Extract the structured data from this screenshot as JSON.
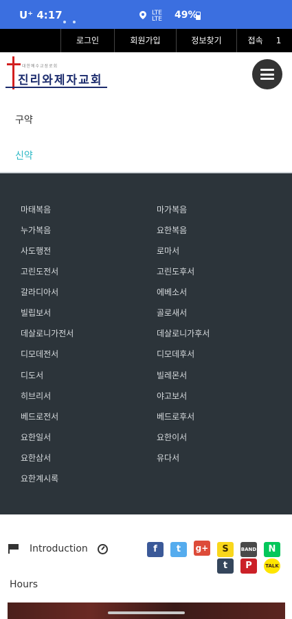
{
  "status_bar": {
    "carrier": "U⁺",
    "time": "4:17",
    "network_type_top": "LTE",
    "network_type_bottom": "LTE",
    "battery": "49%"
  },
  "top_menu": {
    "login": "로그인",
    "join": "회원가입",
    "find_info": "정보찾기",
    "visitors_label": "접속",
    "visitors_count": "1"
  },
  "header": {
    "logo_small_text": "대한예수교장로회",
    "logo_name": "진리와제자교회"
  },
  "testaments": {
    "old": "구약",
    "new": "신약",
    "active_color": "#2db8c5"
  },
  "books": {
    "left": [
      "마태복음",
      "누가복음",
      "사도행전",
      "고린도전서",
      "갈라디아서",
      "빌립보서",
      "데살로니가전서",
      "디모데전서",
      "디도서",
      "히브리서",
      "베드로전서",
      "요한일서",
      "요한삼서",
      "요한계시록"
    ],
    "right": [
      "마가복음",
      "요한복음",
      "로마서",
      "고린도후서",
      "에베소서",
      "골로새서",
      "데살로니가후서",
      "디모데후서",
      "빌레몬서",
      "야고보서",
      "베드로후서",
      "요한이서",
      "유다서"
    ]
  },
  "footer": {
    "introduction": "Introduction",
    "hours": "Hours",
    "share_icons": [
      "facebook-icon",
      "twitter-icon",
      "google-plus-icon",
      "kakaostory-icon",
      "band-icon",
      "naver-icon",
      "tumblr-icon",
      "pinterest-icon",
      "kakaotalk-icon"
    ],
    "share_glyphs": {
      "facebook": "f",
      "twitter": "t",
      "google_plus": "g+",
      "kakaostory": "S",
      "band": "BAND",
      "naver": "N",
      "tumblr": "t",
      "pinterest": "P",
      "kakaotalk": "TALK"
    }
  },
  "colors": {
    "status_bar": "#3b6fe0",
    "top_menu": "#000000",
    "books_panel": "#2c343a",
    "accent": "#2db8c5"
  }
}
